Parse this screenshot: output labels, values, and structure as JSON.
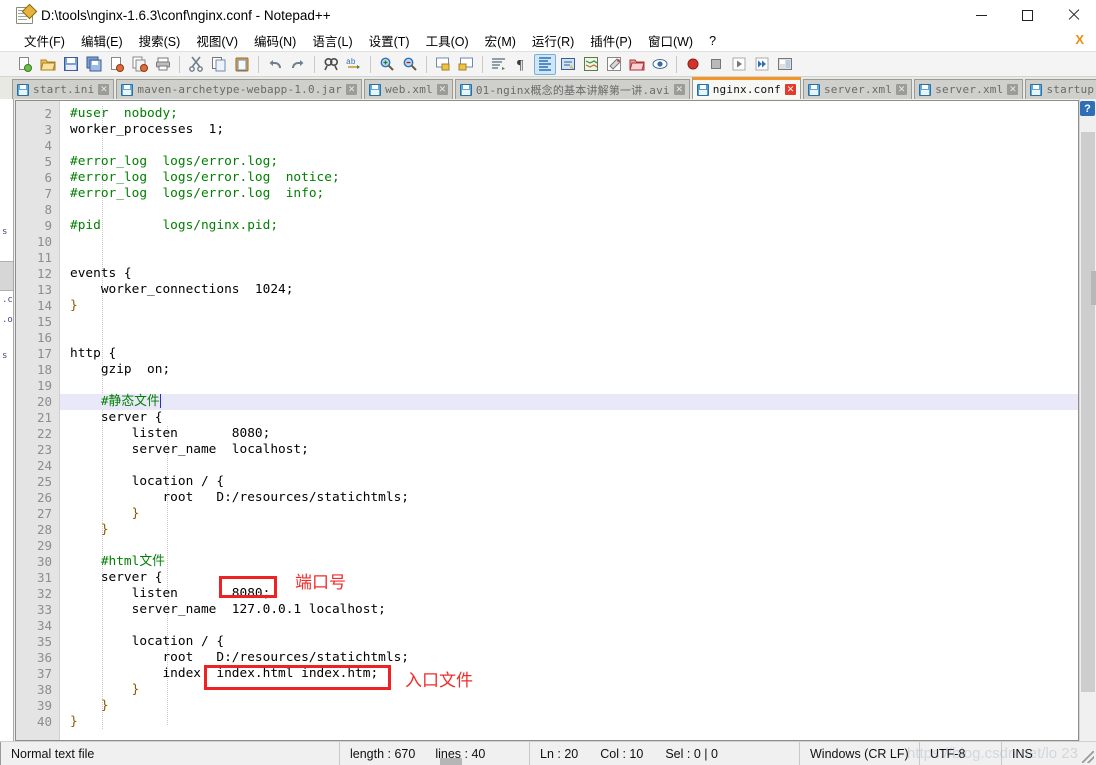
{
  "window": {
    "title": "D:\\tools\\nginx-1.6.3\\conf\\nginx.conf - Notepad++",
    "minimize_label": "—",
    "maximize_label": "□",
    "close_label": "✕",
    "doc_close_label": "X"
  },
  "menu": {
    "items": [
      {
        "label": "文件(F)"
      },
      {
        "label": "编辑(E)"
      },
      {
        "label": "搜索(S)"
      },
      {
        "label": "视图(V)"
      },
      {
        "label": "编码(N)"
      },
      {
        "label": "语言(L)"
      },
      {
        "label": "设置(T)"
      },
      {
        "label": "工具(O)"
      },
      {
        "label": "宏(M)"
      },
      {
        "label": "运行(R)"
      },
      {
        "label": "插件(P)"
      },
      {
        "label": "窗口(W)"
      },
      {
        "label": "?"
      }
    ]
  },
  "toolbar": {
    "buttons": [
      {
        "icon": "new-file-icon",
        "group": 1
      },
      {
        "icon": "open-folder-icon",
        "group": 1
      },
      {
        "icon": "save-icon",
        "group": 1
      },
      {
        "icon": "save-all-icon",
        "group": 1
      },
      {
        "icon": "close-file-icon",
        "group": 1
      },
      {
        "icon": "close-all-files-icon",
        "group": 1
      },
      {
        "icon": "print-icon",
        "group": 1
      },
      {
        "icon": "cut-icon",
        "group": 2
      },
      {
        "icon": "copy-icon",
        "group": 2
      },
      {
        "icon": "paste-icon",
        "group": 2
      },
      {
        "icon": "undo-icon",
        "group": 3
      },
      {
        "icon": "redo-icon",
        "group": 3
      },
      {
        "icon": "find-icon",
        "group": 4
      },
      {
        "icon": "replace-icon",
        "group": 4
      },
      {
        "icon": "zoom-in-icon",
        "group": 5
      },
      {
        "icon": "zoom-out-icon",
        "group": 5
      },
      {
        "icon": "sync-scroll-vertical-icon",
        "group": 6
      },
      {
        "icon": "sync-scroll-horizontal-icon",
        "group": 6
      },
      {
        "icon": "word-wrap-icon",
        "group": 7
      },
      {
        "icon": "show-all-chars-icon",
        "group": 7
      },
      {
        "icon": "indent-guide-icon",
        "group": 7,
        "active": true
      },
      {
        "icon": "user-defined-language-icon",
        "group": 7
      },
      {
        "icon": "document-map-icon",
        "group": 7
      },
      {
        "icon": "function-list-icon",
        "group": 7
      },
      {
        "icon": "folder-as-workspace-icon",
        "group": 7
      },
      {
        "icon": "monitor-icon",
        "group": 7
      },
      {
        "icon": "record-macro-icon",
        "group": 8
      },
      {
        "icon": "stop-macro-icon",
        "group": 8
      },
      {
        "icon": "play-macro-icon",
        "group": 8
      },
      {
        "icon": "run-macro-multiple-icon",
        "group": 8
      },
      {
        "icon": "save-macro-icon",
        "group": 8
      }
    ]
  },
  "tabs": {
    "items": [
      {
        "label": "start.ini",
        "active": false
      },
      {
        "label": "maven-archetype-webapp-1.0.jar",
        "active": false
      },
      {
        "label": "web.xml",
        "active": false
      },
      {
        "label": "01-nginx概念的基本讲解第一讲.avi",
        "active": false
      },
      {
        "label": "nginx.conf",
        "active": true
      },
      {
        "label": "server.xml",
        "active": false
      },
      {
        "label": "server.xml",
        "active": false
      },
      {
        "label": "startup.bat",
        "active": false
      }
    ],
    "close_label": "✕",
    "scroll_left_label": "◀",
    "scroll_right_label": "▶"
  },
  "editor": {
    "first_visible_line": 2,
    "lines": [
      {
        "n": 2,
        "text": "#user  nobody;",
        "type": "comment"
      },
      {
        "n": 3,
        "text": "worker_processes  1;",
        "type": "plain"
      },
      {
        "n": 4,
        "text": "",
        "type": "plain"
      },
      {
        "n": 5,
        "text": "#error_log  logs/error.log;",
        "type": "comment"
      },
      {
        "n": 6,
        "text": "#error_log  logs/error.log  notice;",
        "type": "comment"
      },
      {
        "n": 7,
        "text": "#error_log  logs/error.log  info;",
        "type": "comment"
      },
      {
        "n": 8,
        "text": "",
        "type": "plain"
      },
      {
        "n": 9,
        "text": "#pid        logs/nginx.pid;",
        "type": "comment"
      },
      {
        "n": 10,
        "text": "",
        "type": "plain"
      },
      {
        "n": 11,
        "text": "",
        "type": "plain"
      },
      {
        "n": 12,
        "text": "events {",
        "type": "plain"
      },
      {
        "n": 13,
        "text": "    worker_connections  1024;",
        "type": "plain"
      },
      {
        "n": 14,
        "text": "}",
        "type": "brace"
      },
      {
        "n": 15,
        "text": "",
        "type": "plain"
      },
      {
        "n": 16,
        "text": "",
        "type": "plain"
      },
      {
        "n": 17,
        "text": "http {",
        "type": "plain"
      },
      {
        "n": 18,
        "text": "    gzip  on;",
        "type": "plain"
      },
      {
        "n": 19,
        "text": "",
        "type": "plain"
      },
      {
        "n": 20,
        "text": "    #静态文件",
        "type": "comment",
        "current": true,
        "caret": true
      },
      {
        "n": 21,
        "text": "    server {",
        "type": "plain"
      },
      {
        "n": 22,
        "text": "        listen       8080;",
        "type": "plain"
      },
      {
        "n": 23,
        "text": "        server_name  localhost;",
        "type": "plain"
      },
      {
        "n": 24,
        "text": "",
        "type": "plain"
      },
      {
        "n": 25,
        "text": "        location / {",
        "type": "plain"
      },
      {
        "n": 26,
        "text": "            root   D:/resources/statichtmls;",
        "type": "plain"
      },
      {
        "n": 27,
        "text": "        }",
        "type": "brace"
      },
      {
        "n": 28,
        "text": "    }",
        "type": "brace"
      },
      {
        "n": 29,
        "text": "",
        "type": "plain"
      },
      {
        "n": 30,
        "text": "    #html文件",
        "type": "comment"
      },
      {
        "n": 31,
        "text": "    server {",
        "type": "plain"
      },
      {
        "n": 32,
        "text": "        listen       8080;",
        "type": "plain"
      },
      {
        "n": 33,
        "text": "        server_name  127.0.0.1 localhost;",
        "type": "plain"
      },
      {
        "n": 34,
        "text": "",
        "type": "plain"
      },
      {
        "n": 35,
        "text": "        location / {",
        "type": "plain"
      },
      {
        "n": 36,
        "text": "            root   D:/resources/statichtmls;",
        "type": "plain"
      },
      {
        "n": 37,
        "text": "            index  index.html index.htm;",
        "type": "plain"
      },
      {
        "n": 38,
        "text": "        }",
        "type": "brace"
      },
      {
        "n": 39,
        "text": "    }",
        "type": "brace"
      },
      {
        "n": 40,
        "text": "}",
        "type": "brace"
      }
    ]
  },
  "annotations": {
    "accent_color": "#ee2222",
    "items": [
      {
        "label": "端口号",
        "target": "8080;"
      },
      {
        "label": "入口文件",
        "target": "index.html index.htm;"
      }
    ]
  },
  "scrollbar": {
    "up_arrow": "▲",
    "help_badge": "?"
  },
  "statusbar": {
    "file_type": "Normal text file",
    "length_label": "length : 670",
    "lines_label": "lines : 40",
    "ln": "Ln : 20",
    "col": "Col : 10",
    "sel": "Sel : 0 | 0",
    "eol": "Windows (CR LF)",
    "encoding": "UTF-8",
    "insert_mode": "INS"
  },
  "watermark": {
    "text": "https://blog.csdn.net/lo    23"
  }
}
